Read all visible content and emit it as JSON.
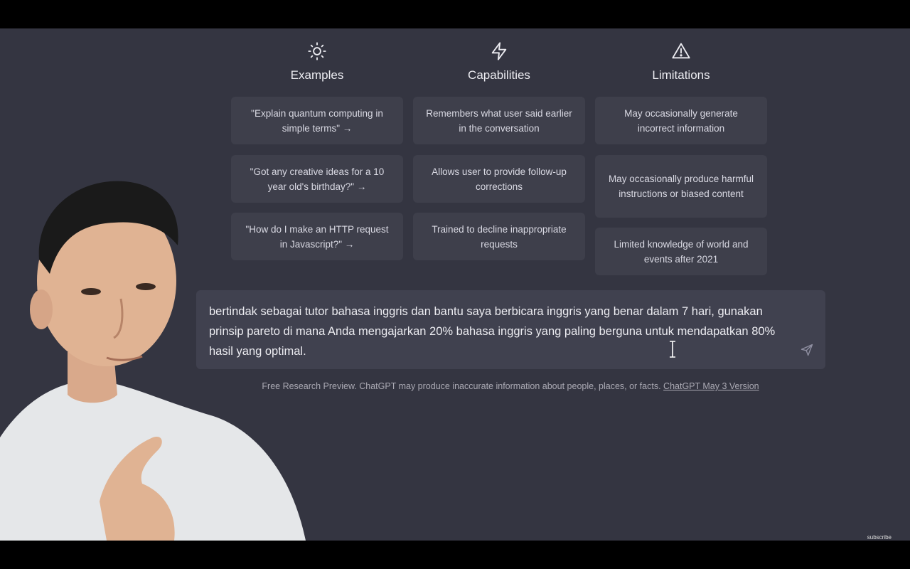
{
  "columns": [
    {
      "title": "Examples",
      "icon": "sun-icon",
      "items": [
        "\"Explain quantum computing in simple terms\" →",
        "\"Got any creative ideas for a 10 year old's birthday?\" →",
        "\"How do I make an HTTP request in Javascript?\" →"
      ]
    },
    {
      "title": "Capabilities",
      "icon": "lightning-icon",
      "items": [
        "Remembers what user said earlier in the conversation",
        "Allows user to provide follow-up corrections",
        "Trained to decline inappropriate requests"
      ]
    },
    {
      "title": "Limitations",
      "icon": "warning-triangle-icon",
      "items": [
        "May occasionally generate incorrect information",
        "May occasionally produce harmful instructions or biased content",
        "Limited knowledge of world and events after 2021"
      ]
    }
  ],
  "prompt": {
    "value": "bertindak sebagai tutor bahasa inggris dan bantu saya berbicara inggris yang benar dalam 7 hari, gunakan prinsip pareto di mana Anda mengajarkan 20% bahasa inggris yang paling berguna untuk mendapatkan 80% hasil yang optimal.",
    "send_icon": "send-icon"
  },
  "footer": {
    "note": "Free Research Preview. ChatGPT may produce inaccurate information about people, places, or facts.",
    "version_link": "ChatGPT May 3 Version"
  },
  "overlay": {
    "subscribe": "subscribe"
  },
  "colors": {
    "background": "#343541",
    "card": "#3e3f4b",
    "input": "#40414f",
    "text": "#ececf1"
  }
}
